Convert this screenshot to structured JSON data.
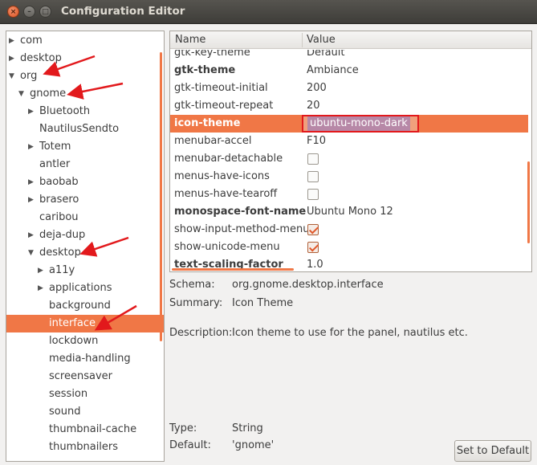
{
  "window": {
    "title": "Configuration Editor",
    "buttons": {
      "close": "×",
      "minimize": "–",
      "maximize": "□"
    }
  },
  "tree": {
    "items": [
      {
        "label": "com",
        "indent": 0,
        "expander": "collapsed"
      },
      {
        "label": "desktop",
        "indent": 0,
        "expander": "collapsed"
      },
      {
        "label": "org",
        "indent": 0,
        "expander": "expanded"
      },
      {
        "label": "gnome",
        "indent": 1,
        "expander": "expanded"
      },
      {
        "label": "Bluetooth",
        "indent": 2,
        "expander": "collapsed"
      },
      {
        "label": "NautilusSendto",
        "indent": 2,
        "expander": "none"
      },
      {
        "label": "Totem",
        "indent": 2,
        "expander": "collapsed"
      },
      {
        "label": "antler",
        "indent": 2,
        "expander": "none"
      },
      {
        "label": "baobab",
        "indent": 2,
        "expander": "collapsed"
      },
      {
        "label": "brasero",
        "indent": 2,
        "expander": "collapsed"
      },
      {
        "label": "caribou",
        "indent": 2,
        "expander": "none"
      },
      {
        "label": "deja-dup",
        "indent": 2,
        "expander": "collapsed"
      },
      {
        "label": "desktop",
        "indent": 2,
        "expander": "expanded"
      },
      {
        "label": "a11y",
        "indent": 3,
        "expander": "collapsed"
      },
      {
        "label": "applications",
        "indent": 3,
        "expander": "collapsed"
      },
      {
        "label": "background",
        "indent": 3,
        "expander": "none"
      },
      {
        "label": "interface",
        "indent": 3,
        "expander": "none",
        "selected": true
      },
      {
        "label": "lockdown",
        "indent": 3,
        "expander": "none"
      },
      {
        "label": "media-handling",
        "indent": 3,
        "expander": "none"
      },
      {
        "label": "screensaver",
        "indent": 3,
        "expander": "none"
      },
      {
        "label": "session",
        "indent": 3,
        "expander": "none"
      },
      {
        "label": "sound",
        "indent": 3,
        "expander": "none"
      },
      {
        "label": "thumbnail-cache",
        "indent": 3,
        "expander": "none"
      },
      {
        "label": "thumbnailers",
        "indent": 3,
        "expander": "none"
      }
    ]
  },
  "keys": {
    "columns": {
      "name": "Name",
      "value": "Value"
    },
    "rows": [
      {
        "name": "gtk-key-theme",
        "bold": false,
        "type": "text",
        "value": "Default"
      },
      {
        "name": "gtk-theme",
        "bold": true,
        "type": "text",
        "value": "Ambiance"
      },
      {
        "name": "gtk-timeout-initial",
        "bold": false,
        "type": "text",
        "value": "200"
      },
      {
        "name": "gtk-timeout-repeat",
        "bold": false,
        "type": "text",
        "value": "20"
      },
      {
        "name": "icon-theme",
        "bold": true,
        "type": "edit",
        "value": "ubuntu-mono-dark",
        "selected": true
      },
      {
        "name": "menubar-accel",
        "bold": false,
        "type": "text",
        "value": "F10"
      },
      {
        "name": "menubar-detachable",
        "bold": false,
        "type": "check",
        "checked": false
      },
      {
        "name": "menus-have-icons",
        "bold": false,
        "type": "check",
        "checked": false
      },
      {
        "name": "menus-have-tearoff",
        "bold": false,
        "type": "check",
        "checked": false
      },
      {
        "name": "monospace-font-name",
        "bold": true,
        "type": "text",
        "value": "Ubuntu Mono 12"
      },
      {
        "name": "show-input-method-menu",
        "bold": false,
        "type": "check",
        "checked": true
      },
      {
        "name": "show-unicode-menu",
        "bold": false,
        "type": "check",
        "checked": true
      },
      {
        "name": "text-scaling-factor",
        "bold": true,
        "type": "text",
        "value": "1.0"
      }
    ]
  },
  "details": {
    "schema_label": "Schema:",
    "schema_value": "org.gnome.desktop.interface",
    "summary_label": "Summary:",
    "summary_value": "Icon Theme",
    "description_label": "Description:",
    "description_value": "Icon theme to use for the panel, nautilus etc.",
    "type_label": "Type:",
    "type_value": "String",
    "default_label": "Default:",
    "default_value": "'gnome'",
    "set_default_button": "Set to Default"
  },
  "colors": {
    "accent": "#f07746",
    "annotation_arrow": "#e2191c"
  }
}
